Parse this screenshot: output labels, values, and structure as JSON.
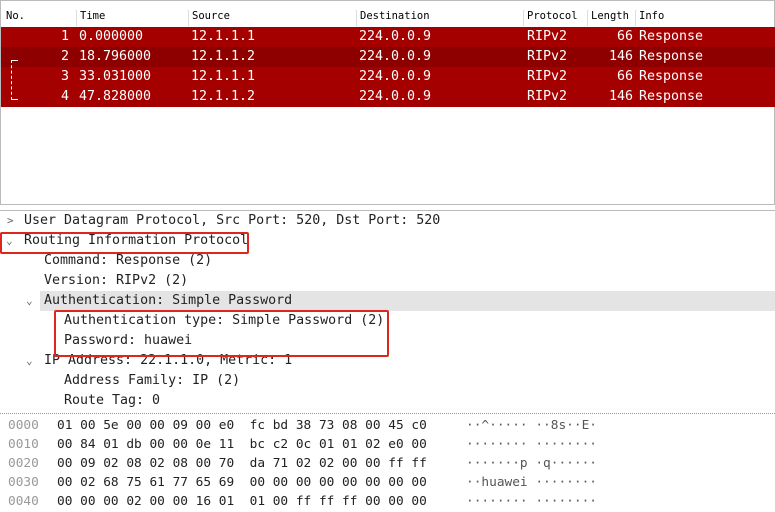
{
  "packet_list": {
    "columns": [
      "No.",
      "Time",
      "Source",
      "Destination",
      "Protocol",
      "Length",
      "Info"
    ],
    "rows": [
      {
        "no": "1",
        "time": "0.000000",
        "source": "12.1.1.1",
        "destination": "224.0.0.9",
        "protocol": "RIPv2",
        "length": "66",
        "info": "Response"
      },
      {
        "no": "2",
        "time": "18.796000",
        "source": "12.1.1.2",
        "destination": "224.0.0.9",
        "protocol": "RIPv2",
        "length": "146",
        "info": "Response"
      },
      {
        "no": "3",
        "time": "33.031000",
        "source": "12.1.1.1",
        "destination": "224.0.0.9",
        "protocol": "RIPv2",
        "length": "66",
        "info": "Response"
      },
      {
        "no": "4",
        "time": "47.828000",
        "source": "12.1.1.2",
        "destination": "224.0.0.9",
        "protocol": "RIPv2",
        "length": "146",
        "info": "Response"
      }
    ],
    "row_color": "#a40000"
  },
  "details": [
    "User Datagram Protocol, Src Port: 520, Dst Port: 520",
    "Routing Information Protocol",
    "Command: Response (2)",
    "Version: RIPv2 (2)",
    "Authentication: Simple Password",
    "Authentication type: Simple Password (2)",
    "Password: huawei",
    "IP Address: 22.1.1.0, Metric: 1",
    "Address Family: IP (2)",
    "Route Tag: 0"
  ],
  "hex": [
    {
      "offset": "0000",
      "bytes": "01 00 5e 00 00 09 00 e0  fc bd 38 73 08 00 45 c0",
      "ascii": "··^····· ··8s··E·"
    },
    {
      "offset": "0010",
      "bytes": "00 84 01 db 00 00 0e 11  bc c2 0c 01 01 02 e0 00",
      "ascii": "········ ········"
    },
    {
      "offset": "0020",
      "bytes": "00 09 02 08 02 08 00 70  da 71 02 02 00 00 ff ff",
      "ascii": "·······p ·q······"
    },
    {
      "offset": "0030",
      "bytes": "00 02 68 75 61 77 65 69  00 00 00 00 00 00 00 00",
      "ascii": "··huawei ········"
    },
    {
      "offset": "0040",
      "bytes": "00 00 00 02 00 00 16 01  01 00 ff ff ff 00 00 00",
      "ascii": "········ ········"
    }
  ],
  "highlight_color": "#e0261c"
}
